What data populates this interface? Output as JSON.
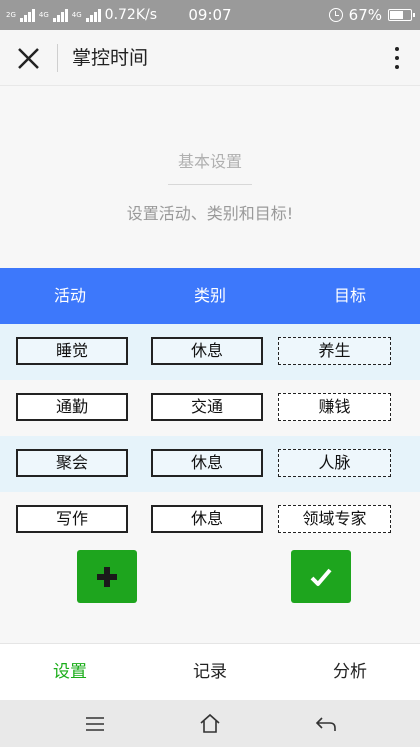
{
  "status_bar": {
    "net_top": "2G",
    "net_labels": [
      "4G",
      "4G"
    ],
    "speed": "0.72K/s",
    "time": "09:07",
    "battery_percent": 67,
    "battery_text": "67%"
  },
  "title_bar": {
    "title": "掌控时间"
  },
  "section": {
    "title": "基本设置",
    "subtitle": "设置活动、类别和目标!"
  },
  "table": {
    "headers": [
      "活动",
      "类别",
      "目标"
    ],
    "rows": [
      {
        "activity": "睡觉",
        "category": "休息",
        "goal": "养生"
      },
      {
        "activity": "通勤",
        "category": "交通",
        "goal": "赚钱"
      },
      {
        "activity": "聚会",
        "category": "休息",
        "goal": "人脉"
      },
      {
        "activity": "写作",
        "category": "休息",
        "goal": "领域专家"
      }
    ]
  },
  "tabs": [
    {
      "label": "设置",
      "active": true
    },
    {
      "label": "记录",
      "active": false
    },
    {
      "label": "分析",
      "active": false
    }
  ],
  "colors": {
    "header_blue": "#3d78fb",
    "accent_green": "#1aad19",
    "button_green": "#1ea51e"
  }
}
